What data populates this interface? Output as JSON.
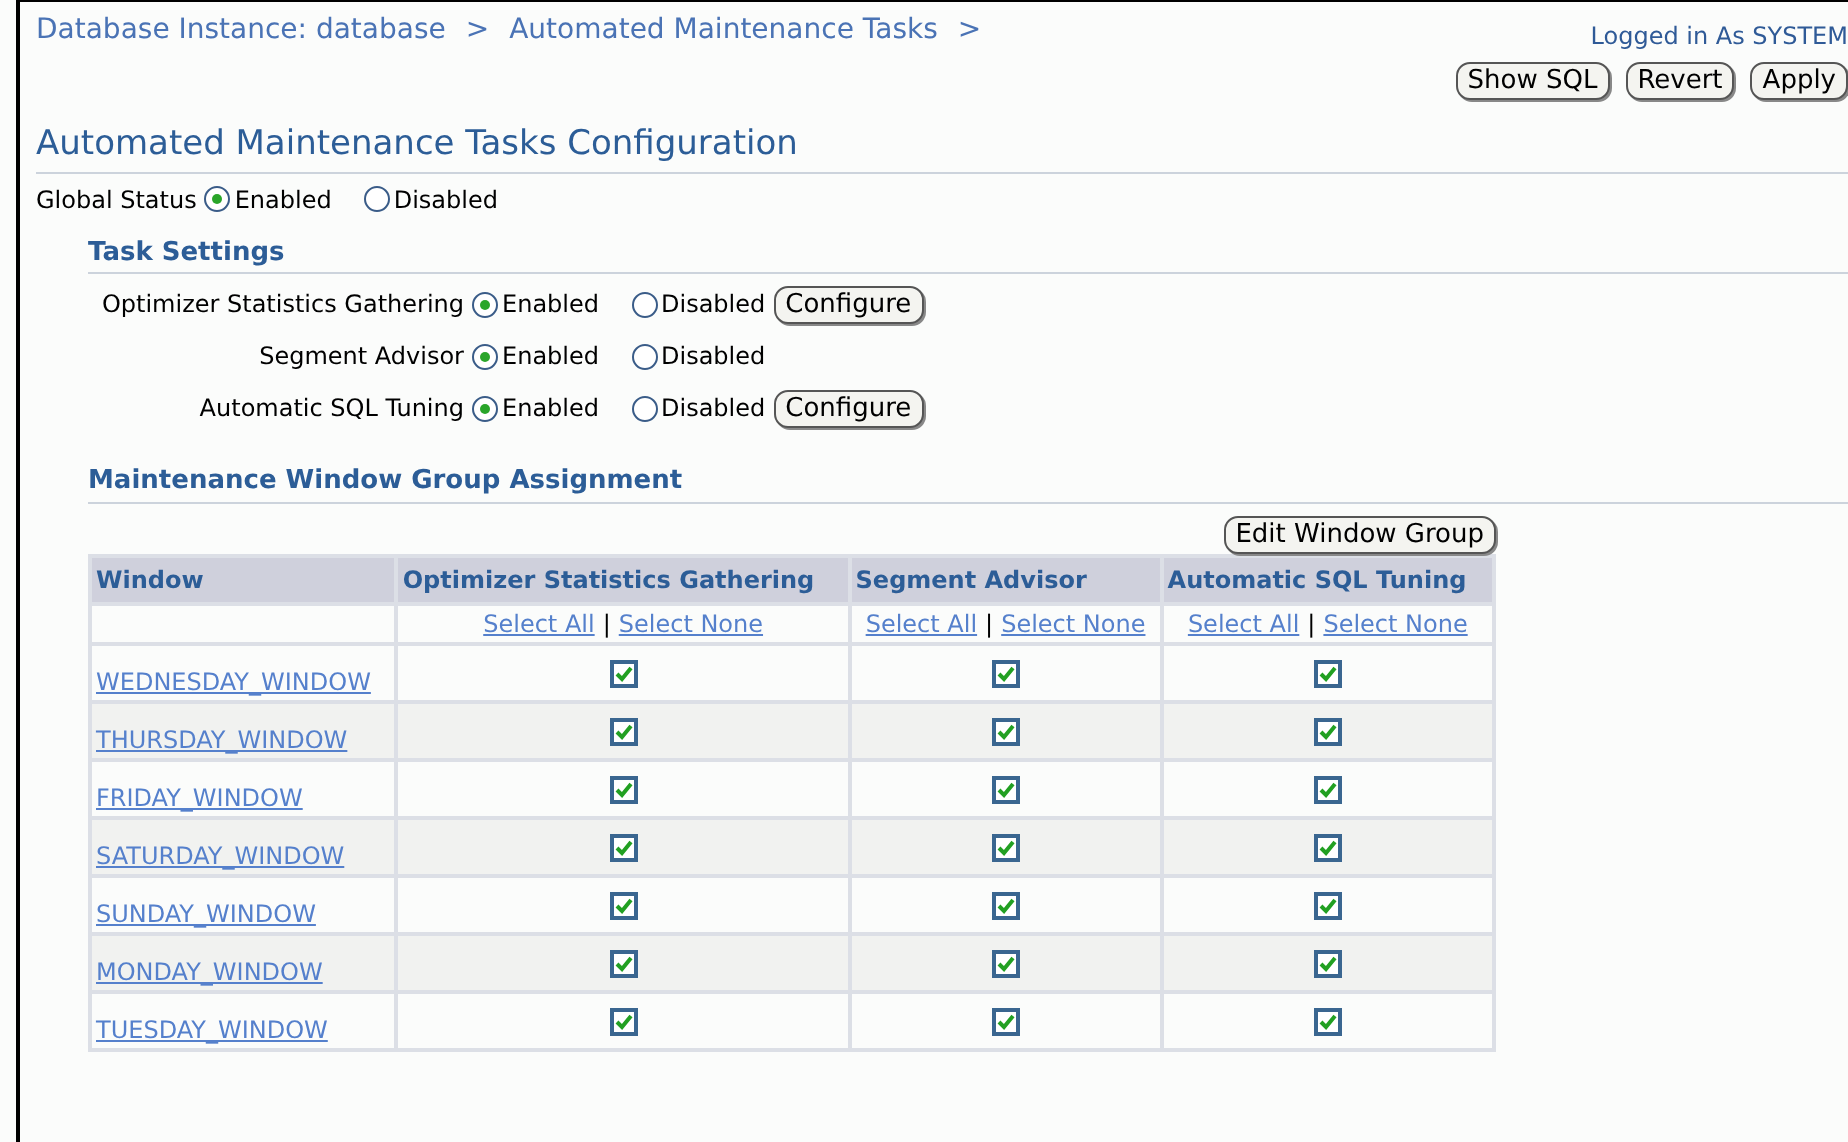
{
  "breadcrumbs": [
    {
      "label": "Database Instance: database",
      "separator": ">"
    },
    {
      "label": "Automated Maintenance Tasks",
      "separator": ">"
    }
  ],
  "logged_in": "Logged in As SYSTEM",
  "actions": [
    "Show SQL",
    "Revert",
    "Apply"
  ],
  "title": "Automated Maintenance Tasks Configuration",
  "global_status": {
    "label": "Global Status",
    "options": [
      {
        "label": "Enabled",
        "selected": true
      },
      {
        "label": "Disabled",
        "selected": false
      }
    ]
  },
  "task_settings": {
    "heading": "Task Settings",
    "tasks": [
      {
        "label": "Optimizer Statistics Gathering",
        "options": [
          {
            "label": "Enabled",
            "selected": true
          },
          {
            "label": "Disabled",
            "selected": false
          }
        ],
        "configure": "Configure"
      },
      {
        "label": "Segment Advisor",
        "options": [
          {
            "label": "Enabled",
            "selected": true
          },
          {
            "label": "Disabled",
            "selected": false
          }
        ]
      },
      {
        "label": "Automatic SQL Tuning",
        "options": [
          {
            "label": "Enabled",
            "selected": true
          },
          {
            "label": "Disabled",
            "selected": false
          }
        ],
        "configure": "Configure"
      }
    ]
  },
  "assignment": {
    "heading": "Maintenance Window Group Assignment",
    "edit_button": "Edit Window Group",
    "columns": [
      "Window",
      "Optimizer Statistics Gathering",
      "Segment Advisor",
      "Automatic SQL Tuning"
    ],
    "select_links": [
      {
        "all": "Select All",
        "separator": "|",
        "none": "Select None"
      },
      {
        "all": "Select All",
        "separator": "|",
        "none": "Select None"
      },
      {
        "all": "Select All",
        "separator": "|",
        "none": "Select None"
      }
    ],
    "rows": [
      {
        "window": "WEDNESDAY_WINDOW",
        "checks": [
          true,
          true,
          true
        ]
      },
      {
        "window": "THURSDAY_WINDOW",
        "checks": [
          true,
          true,
          true
        ]
      },
      {
        "window": "FRIDAY_WINDOW",
        "checks": [
          true,
          true,
          true
        ]
      },
      {
        "window": "SATURDAY_WINDOW",
        "checks": [
          true,
          true,
          true
        ]
      },
      {
        "window": "SUNDAY_WINDOW",
        "checks": [
          true,
          true,
          true
        ]
      },
      {
        "window": "MONDAY_WINDOW",
        "checks": [
          true,
          true,
          true
        ]
      },
      {
        "window": "TUESDAY_WINDOW",
        "checks": [
          true,
          true,
          true
        ]
      }
    ]
  }
}
